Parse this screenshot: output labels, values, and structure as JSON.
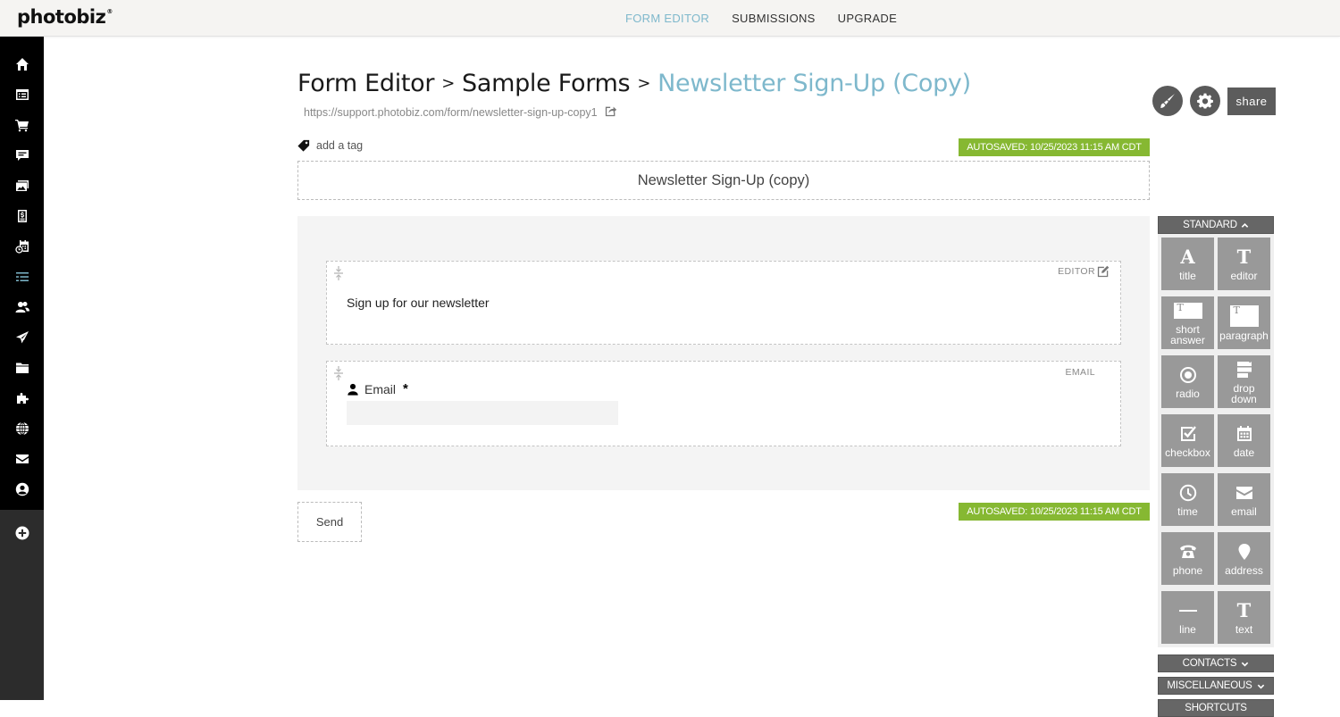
{
  "app": {
    "logo": "photobiz"
  },
  "topnav": [
    {
      "label": "FORM EDITOR",
      "active": true
    },
    {
      "label": "SUBMISSIONS",
      "active": false
    },
    {
      "label": "UPGRADE",
      "active": false
    }
  ],
  "sidebar": {
    "items": [
      {
        "icon": "home-icon"
      },
      {
        "icon": "website-icon"
      },
      {
        "icon": "cart-icon"
      },
      {
        "icon": "chat-icon"
      },
      {
        "icon": "gallery-icon"
      },
      {
        "icon": "invoice-icon"
      },
      {
        "icon": "calendar-clock-icon"
      },
      {
        "icon": "forms-icon",
        "active": true
      },
      {
        "icon": "contacts-icon"
      },
      {
        "icon": "send-icon"
      },
      {
        "icon": "folder-icon"
      },
      {
        "icon": "puzzle-icon"
      },
      {
        "icon": "globe-icon"
      },
      {
        "icon": "mail-icon"
      },
      {
        "icon": "account-icon"
      }
    ],
    "add_icon": "plus-circle-icon"
  },
  "header": {
    "breadcrumb": [
      "Form Editor",
      "Sample Forms",
      "Newsletter Sign-Up (Copy)"
    ],
    "separator": ">",
    "url": "https://support.photobiz.com/form/newsletter-sign-up-copy1",
    "share_label": "share",
    "add_tag_label": "add a tag"
  },
  "autosave": {
    "text": "AUTOSAVED: 10/25/2023 11:15 AM CDT",
    "color": "#86b832"
  },
  "form": {
    "title": "Newsletter Sign-Up (copy)",
    "blocks": [
      {
        "type_label": "EDITOR",
        "content": "Sign up for our newsletter"
      },
      {
        "type_label": "EMAIL",
        "label": "Email",
        "required_mark": "*",
        "value": ""
      }
    ],
    "send_label": "Send"
  },
  "palette": {
    "standard_label": "STANDARD",
    "items": [
      {
        "label": "title"
      },
      {
        "label": "editor"
      },
      {
        "label": "short answer"
      },
      {
        "label": "paragraph"
      },
      {
        "label": "radio"
      },
      {
        "label": "drop down"
      },
      {
        "label": "checkbox"
      },
      {
        "label": "date"
      },
      {
        "label": "time"
      },
      {
        "label": "email"
      },
      {
        "label": "phone"
      },
      {
        "label": "address"
      },
      {
        "label": "line"
      },
      {
        "label": "text"
      }
    ],
    "glyph_A": "A",
    "glyph_T": "T",
    "sections": [
      "CONTACTS",
      "MISCELLANEOUS",
      "SHORTCUTS"
    ]
  },
  "colors": {
    "accent": "#7eb8cc",
    "sidebar_bg": "#000000",
    "palette_tile": "#999999"
  }
}
